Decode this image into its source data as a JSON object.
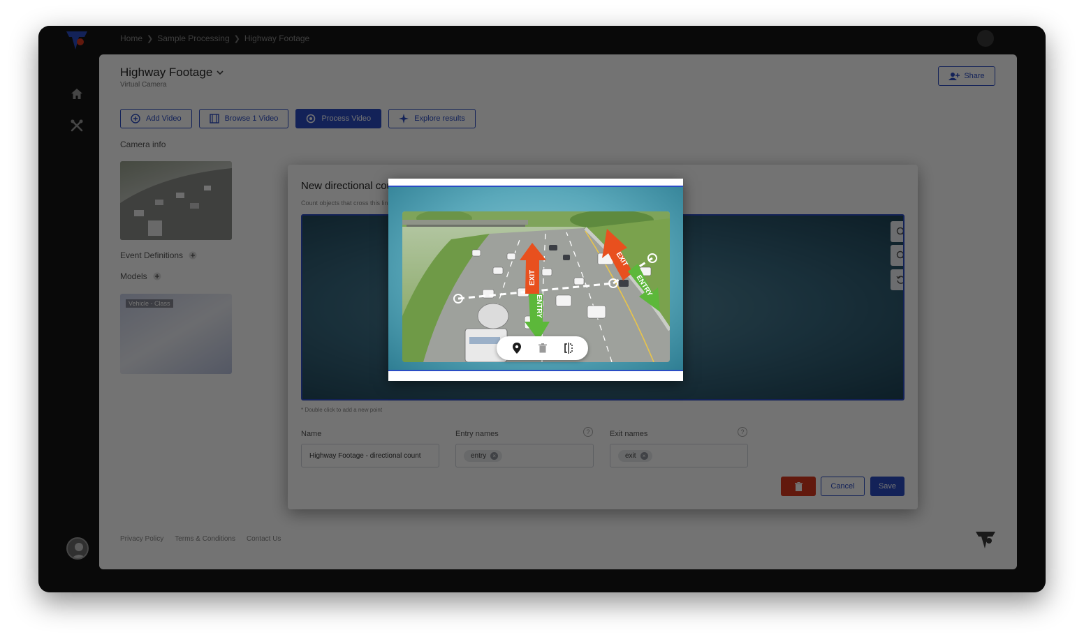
{
  "breadcrumb": {
    "items": [
      "Home",
      "Sample Processing",
      "Highway Footage"
    ],
    "separator": "❯"
  },
  "page": {
    "title": "Highway Footage",
    "subtitle": "Virtual Camera",
    "share_label": "Share"
  },
  "toolbar": {
    "add_video": "Add Video",
    "browse_videos": "Browse 1 Video",
    "process_video": "Process Video",
    "explore_results": "Explore results"
  },
  "sections": {
    "camera_info": "Camera info",
    "event_definitions": "Event Definitions",
    "models": "Models"
  },
  "model_card": {
    "label": "Vehicle - Class"
  },
  "footer": {
    "privacy": "Privacy Policy",
    "terms": "Terms & Conditions",
    "contact": "Contact Us"
  },
  "modal": {
    "title": "New directional count",
    "subtitle": "Count objects that cross this line with the direction of travel",
    "canvas_hint": "* Double click to add a new point",
    "name_label": "Name",
    "name_value": "Highway Footage - directional count",
    "entry_label": "Entry names",
    "entry_chip": "entry",
    "exit_label": "Exit names",
    "exit_chip": "exit",
    "help_glyph": "?",
    "chip_close": "×",
    "cancel_label": "Cancel",
    "save_label": "Save"
  },
  "annotation": {
    "arrow_exit_label": "EXIT",
    "arrow_entry_label": "ENTRY",
    "exit_color": "#e8501e",
    "entry_color": "#5cb83a"
  },
  "colors": {
    "accent": "#2a4cc4",
    "danger": "#d9381e"
  },
  "icons": {
    "nav": [
      "home-icon",
      "tools-icon"
    ],
    "popup_toolbar": [
      "map-pin-icon",
      "trash-icon",
      "flip-direction-icon"
    ],
    "zoom": [
      "zoom-in-icon",
      "zoom-out-icon",
      "reset-view-icon"
    ]
  }
}
